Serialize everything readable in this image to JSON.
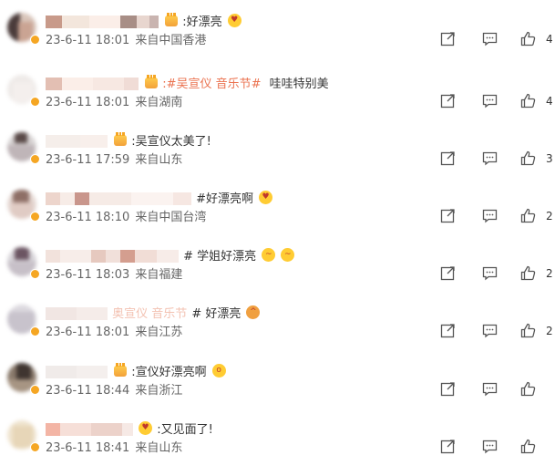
{
  "comments": [
    {
      "text": ":好漂亮",
      "topic": "",
      "time": "23-6-11 18:01",
      "location": "来自中国香港",
      "likes": "4",
      "emoji": "heart-eyes"
    },
    {
      "text": "哇哇特别美",
      "topic": ":#吴宣仪 音乐节#",
      "time": "23-6-11 18:01",
      "location": "来自湖南",
      "likes": "4",
      "emoji": ""
    },
    {
      "text": ":吴宣仪太美了!",
      "topic": "",
      "time": "23-6-11 17:59",
      "location": "来自山东",
      "likes": "3",
      "emoji": ""
    },
    {
      "text": "#好漂亮啊",
      "topic": "",
      "time": "23-6-11 18:10",
      "location": "来自中国台湾",
      "likes": "2",
      "emoji": "heart-eyes"
    },
    {
      "text": "# 学姐好漂亮",
      "topic": "",
      "time": "23-6-11 18:03",
      "location": "来自福建",
      "likes": "2",
      "emoji": "drool"
    },
    {
      "text": "# 好漂亮",
      "topic": "奥宣仪 音乐节",
      "time": "23-6-11 18:01",
      "location": "来自江苏",
      "likes": "2",
      "emoji": "cat"
    },
    {
      "text": ":宣仪好漂亮啊",
      "topic": "",
      "time": "23-6-11 18:44",
      "location": "来自浙江",
      "likes": "",
      "emoji": "wow"
    },
    {
      "text": ":又见面了!",
      "topic": "",
      "time": "23-6-11 18:41",
      "location": "来自山东",
      "likes": "",
      "emoji": ""
    }
  ],
  "icons": {
    "share": "share-icon",
    "comment": "comment-icon",
    "like": "thumbs-up-icon"
  }
}
